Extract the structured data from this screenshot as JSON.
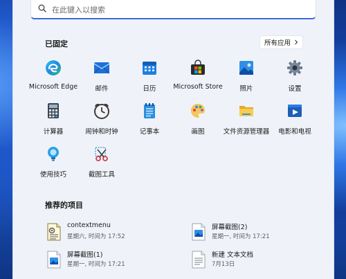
{
  "search": {
    "placeholder": "在此键入以搜索"
  },
  "pinned": {
    "title": "已固定",
    "all_apps_label": "所有应用",
    "apps": [
      {
        "label": "Microsoft Edge",
        "icon": "edge-icon"
      },
      {
        "label": "邮件",
        "icon": "mail-icon"
      },
      {
        "label": "日历",
        "icon": "calendar-icon"
      },
      {
        "label": "Microsoft Store",
        "icon": "store-icon"
      },
      {
        "label": "照片",
        "icon": "photos-icon"
      },
      {
        "label": "设置",
        "icon": "settings-icon"
      },
      {
        "label": "计算器",
        "icon": "calculator-icon"
      },
      {
        "label": "闹钟和时钟",
        "icon": "clock-icon"
      },
      {
        "label": "记事本",
        "icon": "notepad-icon"
      },
      {
        "label": "画图",
        "icon": "paint-icon"
      },
      {
        "label": "文件资源管理器",
        "icon": "folder-icon"
      },
      {
        "label": "电影和电视",
        "icon": "movies-icon"
      },
      {
        "label": "使用技巧",
        "icon": "tips-icon"
      },
      {
        "label": "截图工具",
        "icon": "snipping-tool-icon"
      }
    ]
  },
  "recommended": {
    "title": "推荐的项目",
    "items": [
      {
        "name": "contextmenu",
        "time": "星期六, 时间为 17:52",
        "icon": "script-file-icon"
      },
      {
        "name": "屏幕截图(2)",
        "time": "星期一, 时间为 17:21",
        "icon": "image-file-icon"
      },
      {
        "name": "屏幕截图(1)",
        "time": "星期一, 时间为 17:21",
        "icon": "image-file-icon"
      },
      {
        "name": "新建 文本文档",
        "time": "7月13日",
        "icon": "text-file-icon"
      }
    ]
  }
}
